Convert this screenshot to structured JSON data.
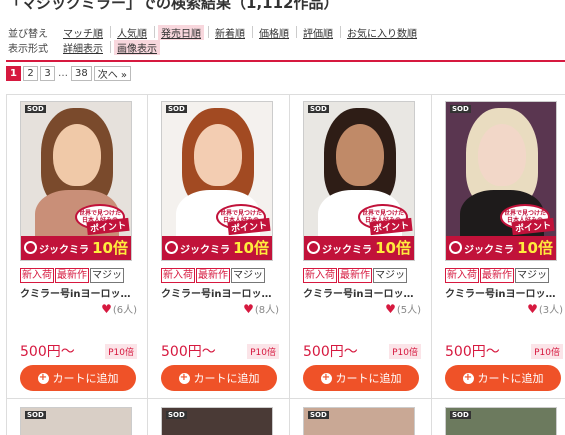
{
  "header": {
    "title": "「マジックミラー」での検索結果（1,112作品）"
  },
  "sort": {
    "label": "並び替え",
    "options": [
      "マッチ順",
      "人気順",
      "発売日順",
      "新着順",
      "価格順",
      "評価順",
      "お気に入り数順"
    ],
    "active_index": 2
  },
  "format": {
    "label": "表示形式",
    "options": [
      "詳細表示",
      "画像表示"
    ],
    "active_index": 1
  },
  "pagination": {
    "pages": [
      "1",
      "2",
      "3"
    ],
    "current": "1",
    "ellipsis": "…",
    "last": "38",
    "next": "次へ »"
  },
  "products": [
    {
      "maker": "SOD",
      "tags": [
        "新入荷",
        "最新作",
        "マジッ"
      ],
      "title": "クミラー号inヨーロッ…",
      "favorites": "(6人)",
      "price": "500円～",
      "point_badge": "P10倍",
      "cart_label": "カートに追加",
      "cover": {
        "world": "世界で見つけた日本人好みの",
        "point": "ポイント",
        "logo": "ジックミラ",
        "ten": "10倍",
        "hair": "#7a4a2c",
        "skin": "#f0c9a8",
        "top": "#c98f78",
        "bg": "#e6e1dc"
      }
    },
    {
      "maker": "SOD",
      "tags": [
        "新入荷",
        "最新作",
        "マジッ"
      ],
      "title": "クミラー号inヨーロッ…",
      "favorites": "(8人)",
      "price": "500円～",
      "point_badge": "P10倍",
      "cart_label": "カートに追加",
      "cover": {
        "world": "世界で見つけた日本人好みの",
        "point": "ポイント",
        "logo": "ジックミラ",
        "ten": "10倍",
        "hair": "#a24a22",
        "skin": "#f3cdb2",
        "top": "#ffffff",
        "bg": "#f4f1ee"
      }
    },
    {
      "maker": "SOD",
      "tags": [
        "新入荷",
        "最新作",
        "マジッ"
      ],
      "title": "クミラー号inヨーロッ…",
      "favorites": "(5人)",
      "price": "500円～",
      "point_badge": "P10倍",
      "cart_label": "カートに追加",
      "cover": {
        "world": "世界で見つけた日本人好みの",
        "point": "ポイント",
        "logo": "ジックミラ",
        "ten": "10倍",
        "hair": "#2e1d16",
        "skin": "#c08a68",
        "top": "#ffffff",
        "bg": "#e9e7e3"
      }
    },
    {
      "maker": "SOD",
      "tags": [
        "新入荷",
        "最新作",
        "マジッ"
      ],
      "title": "クミラー号inヨーロッ…",
      "favorites": "(3人)",
      "price": "500円～",
      "point_badge": "P10倍",
      "cart_label": "カートに追加",
      "cover": {
        "world": "世界で見つけた日本人好みの",
        "point": "ポイント",
        "logo": "ジックミラ",
        "ten": "10倍",
        "hair": "#e9dcc0",
        "skin": "#f2d7c8",
        "top": "#1e1b1b",
        "bg": "#5a3650"
      }
    }
  ],
  "next_row": [
    {
      "maker": "SOD",
      "bg": "#d9cfc6"
    },
    {
      "maker": "SOD",
      "bg": "#4a3a36"
    },
    {
      "maker": "SOD",
      "bg": "#c9a895"
    },
    {
      "maker": "SOD",
      "bg": "#6c7a5e"
    }
  ],
  "colors": {
    "accent": "#d6193f",
    "cart": "#ef5228",
    "point_bg": "#fbe4e8"
  }
}
